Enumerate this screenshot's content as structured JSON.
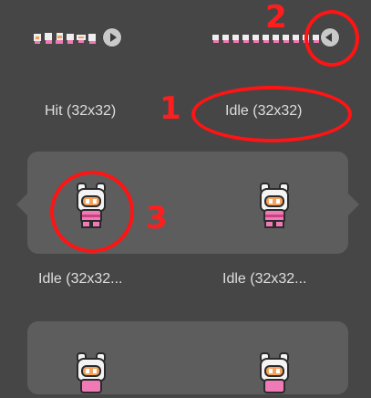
{
  "theme": {
    "background": "#464646",
    "panel": "#5d5d5d",
    "annotation": "#ff1414",
    "label_color": "#dedede"
  },
  "assets": {
    "row1": [
      {
        "label": "Hit (32x32)",
        "control": "play-icon"
      },
      {
        "label": "Idle (32x32)",
        "control": "collapse-arrow-icon"
      }
    ],
    "row2": [
      {
        "label": "Idle (32x32..."
      },
      {
        "label": "Idle (32x32..."
      }
    ]
  },
  "annotations": {
    "one": "1",
    "two": "2",
    "three": "3"
  }
}
